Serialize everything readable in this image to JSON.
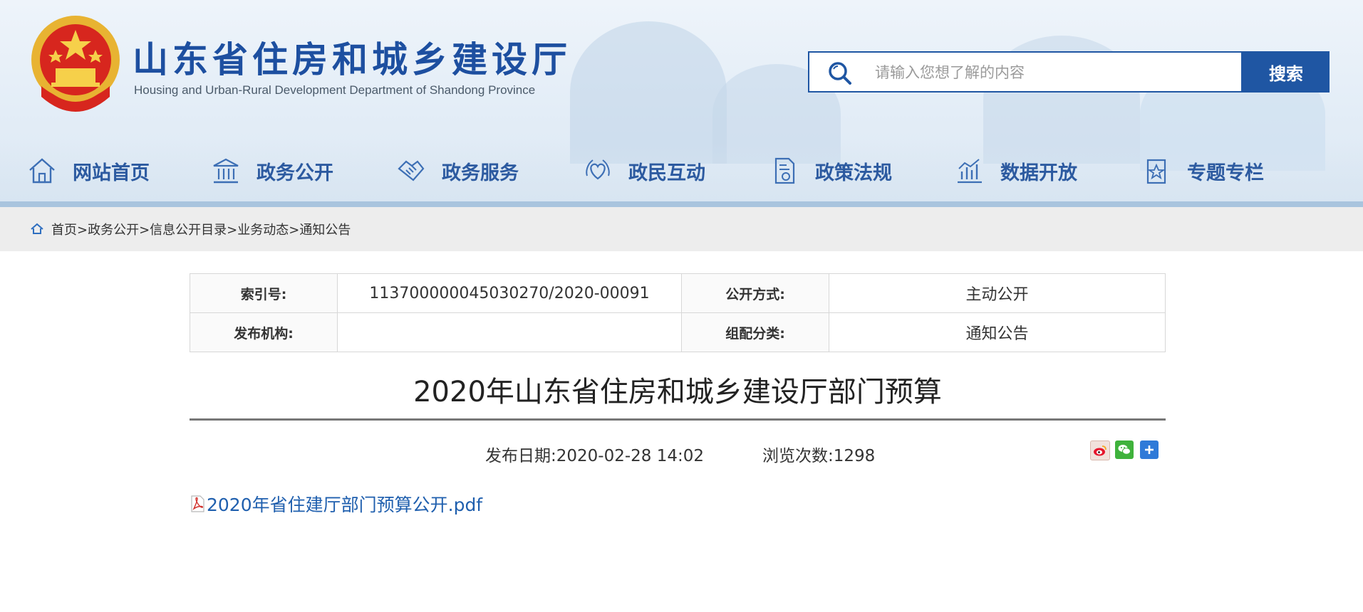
{
  "header": {
    "title": "山东省住房和城乡建设厅",
    "subtitle": "Housing and Urban-Rural Development Department of Shandong Province"
  },
  "search": {
    "placeholder": "请输入您想了解的内容",
    "button_label": "搜索"
  },
  "nav": {
    "items": [
      {
        "label": "网站首页",
        "icon": "home-icon"
      },
      {
        "label": "政务公开",
        "icon": "government-building-icon"
      },
      {
        "label": "政务服务",
        "icon": "handshake-icon"
      },
      {
        "label": "政民互动",
        "icon": "heart-hands-icon"
      },
      {
        "label": "政策法规",
        "icon": "document-icon"
      },
      {
        "label": "数据开放",
        "icon": "bar-chart-icon"
      },
      {
        "label": "专题专栏",
        "icon": "star-document-icon"
      }
    ]
  },
  "breadcrumb": {
    "text": "首页>政务公开>信息公开目录>业务动态>通知公告"
  },
  "meta": {
    "index_label": "索引号:",
    "index_value": "11370000004503027​0/2020-00091",
    "method_label": "公开方式:",
    "method_value": "主动公开",
    "publisher_label": "发布机构:",
    "publisher_value": "",
    "category_label": "组配分类:",
    "category_value": "通知公告"
  },
  "article": {
    "title": "2020年山东省住房和城乡建设厅部门预算",
    "publish_date": "发布日期:2020-02-28 14:02",
    "views": "浏览次数:1298",
    "attachment": "2020年省住建厅部门预算公开.pdf"
  },
  "share": {
    "icons": [
      "weibo-icon",
      "wechat-icon",
      "add-share-icon"
    ]
  },
  "colors": {
    "brand_blue": "#1f56a3",
    "nav_text": "#2c5aa0",
    "link": "#1f5fae"
  }
}
